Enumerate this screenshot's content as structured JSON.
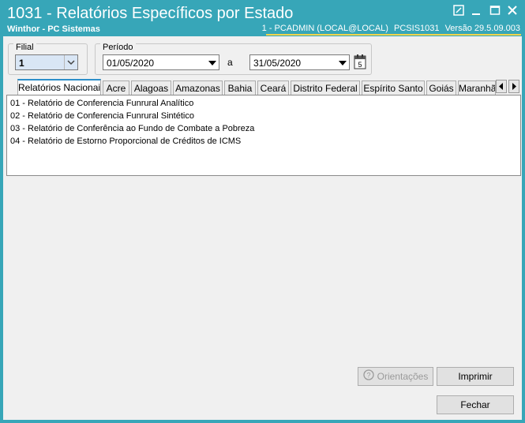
{
  "window": {
    "title": "1031 - Relatórios Específicos por Estado",
    "subtitle": "Winthor - PC Sistemas",
    "status": {
      "user": "1 - PCADMIN (LOCAL@LOCAL)",
      "routine": "PCSIS1031",
      "version": "Versão  29.5.09.003"
    },
    "controls": [
      "pin-icon",
      "minimize-icon",
      "maximize-icon",
      "close-icon"
    ]
  },
  "filial": {
    "label": "Filial",
    "value": "1"
  },
  "periodo": {
    "label": "Período",
    "start": "01/05/2020",
    "separator": "a",
    "end": "31/05/2020",
    "calendar_day": "5"
  },
  "tabs": [
    "Relatórios Nacionais",
    "Acre",
    "Alagoas",
    "Amazonas",
    "Bahia",
    "Ceará",
    "Distrito Federal",
    "Espírito Santo",
    "Goiás",
    "Maranhão"
  ],
  "active_tab": "Relatórios Nacionais",
  "reports": [
    "01 - Relatório de Conferencia Funrural Analítico",
    "02 - Relatório de Conferencia Funrural Sintético",
    "03 - Relatório de Conferência ao Fundo de Combate a Pobreza",
    "04 - Relatório de Estorno Proporcional de Créditos de ICMS"
  ],
  "buttons": {
    "orientacoes": "Orientações",
    "imprimir": "Imprimir",
    "fechar": "Fechar"
  },
  "colors": {
    "titlebar": "#37a6b8",
    "accent": "#f1d44a",
    "active_tab_border": "#2d8fc9"
  }
}
